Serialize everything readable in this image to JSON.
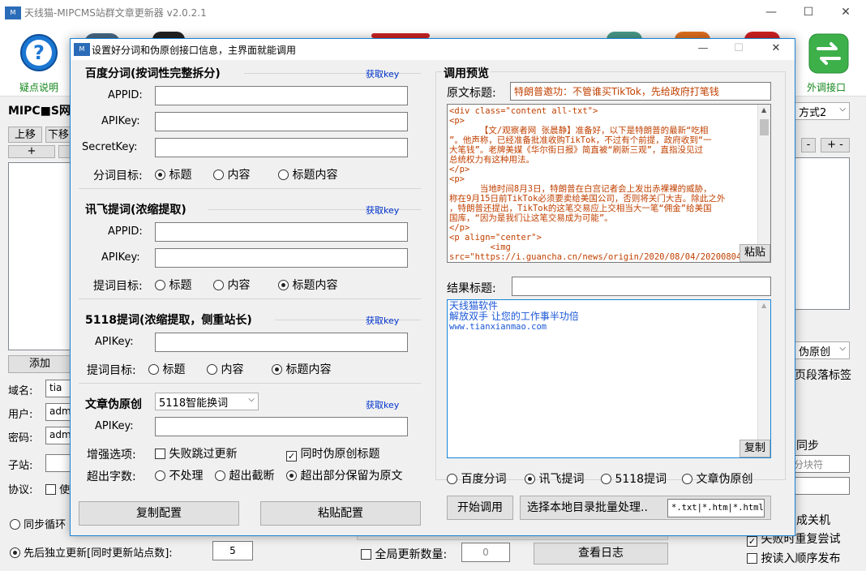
{
  "main": {
    "title": "天线猫-MIPCMS站群文章更新器 v2.0.2.1",
    "logo_text": "M",
    "controls": {
      "minimize": "—",
      "maximize": "☐",
      "close": "✕"
    },
    "toolbar": {
      "help_label": "疑点说明",
      "external_label": "外调接口"
    },
    "section_title": "MIPC■S网站",
    "buttons": {
      "move_up": "上移",
      "move_down": "下移",
      "plus": "+",
      "minus": "-",
      "add": "添加",
      "view_log": "查看日志"
    },
    "fields": {
      "domain_label": "域名:",
      "domain_value": "tia",
      "user_label": "用户:",
      "user_value": "admi",
      "password_label": "密码:",
      "password_value": "admi",
      "substation_label": "子站:",
      "protocol_label": "协议:",
      "protocol_option": "使"
    },
    "right": {
      "mode_select": "方式2",
      "pseudo_select": "伪原创",
      "paragraph_tag": "页段落标签",
      "sync_label": "同步",
      "separator_placeholder": "分块符"
    },
    "bottom": {
      "sync_loop": "同步循环",
      "independent_update": "先后独立更新[同时更新站点数]:",
      "concurrent_sites": "5",
      "global_update_count": "全局更新数量:",
      "global_count_value": "0",
      "shutdown": "成关机",
      "retry_on_fail": "失败时重复尝试",
      "publish_in_order": "按读入顺序发布"
    }
  },
  "dialog": {
    "title": "设置好分词和伪原创接口信息，主界面就能调用",
    "logo_text": "M",
    "controls": {
      "minimize": "—",
      "maximize": "☐",
      "close": "✕"
    },
    "baidu": {
      "title": "百度分词(按词性完整拆分)",
      "get_key": "获取key",
      "appid_label": "APPID:",
      "apikey_label": "APIKey:",
      "secretkey_label": "SecretKey:",
      "target_label": "分词目标:",
      "options": [
        "标题",
        "内容",
        "标题内容"
      ]
    },
    "xunfei": {
      "title": "讯飞提词(浓缩提取)",
      "get_key": "获取key",
      "appid_label": "APPID:",
      "apikey_label": "APIKey:",
      "target_label": "提词目标:",
      "options": [
        "标题",
        "内容",
        "标题内容"
      ]
    },
    "k5118": {
      "title": "5118提词(浓缩提取，侧重站长)",
      "get_key": "获取key",
      "apikey_label": "APIKey:",
      "target_label": "提词目标:",
      "options": [
        "标题",
        "内容",
        "标题内容"
      ]
    },
    "rewrite": {
      "title": "文章伪原创",
      "engine": "5118智能换词",
      "get_key": "获取key",
      "apikey_label": "APIKey:",
      "enhance_label": "增强选项:",
      "skip_on_fail": "失败跳过更新",
      "rewrite_title": "同时伪原创标题",
      "overflow_label": "超出字数:",
      "overflow_options": [
        "不处理",
        "超出截断",
        "超出部分保留为原文"
      ]
    },
    "copy_config": "复制配置",
    "paste_config": "粘贴配置",
    "preview": {
      "title": "调用预览",
      "source_title_label": "原文标题:",
      "source_title_value": "特朗普邀功：不管谁买TikTok，先给政府打笔钱",
      "source_content": [
        "<div class=\"content all-txt\">",
        "<p>",
        "      【文/观察者网 张晨静】准备好，以下是特朗普的最新“吃相",
        "”。他声称，已经准备批准收购TikTok，不过有个前提，政府收到“一",
        "大笔钱”。老牌美媒《华尔街日报》简直被“刷新三观”，直指没见过",
        "总统权力有这种用法。",
        "</p>",
        "<p>",
        "      当地时间8月3日，特朗普在白宫记者会上发出赤裸裸的威胁，",
        "称在9月15日前TikTok必须要卖给美国公司，否则将关门大吉。除此之外",
        "，特朗普还提出，TikTok的这笔交易应上交相当大一笔“佣金”给美国",
        "国库，“因为是我们让这笔交易成为可能”。",
        "</p>",
        "<p align=\"center\">",
        "        <img",
        "src=\"https://i.guancha.cn/news/origin/2020/08/04/20200804083"
      ],
      "paste_button": "粘贴",
      "result_title_label": "结果标题:",
      "result_content": [
        "天线猫软件",
        "解放双手 让您的工作事半功倍",
        "www.tianxianmao.com"
      ],
      "copy_button": "复制",
      "call_options": [
        "百度分词",
        "讯飞提词",
        "5118提词",
        "文章伪原创"
      ],
      "start_button": "开始调用",
      "batch_button": "选择本地目录批量处理..",
      "extensions": "*.txt|*.htm|*.html"
    }
  }
}
